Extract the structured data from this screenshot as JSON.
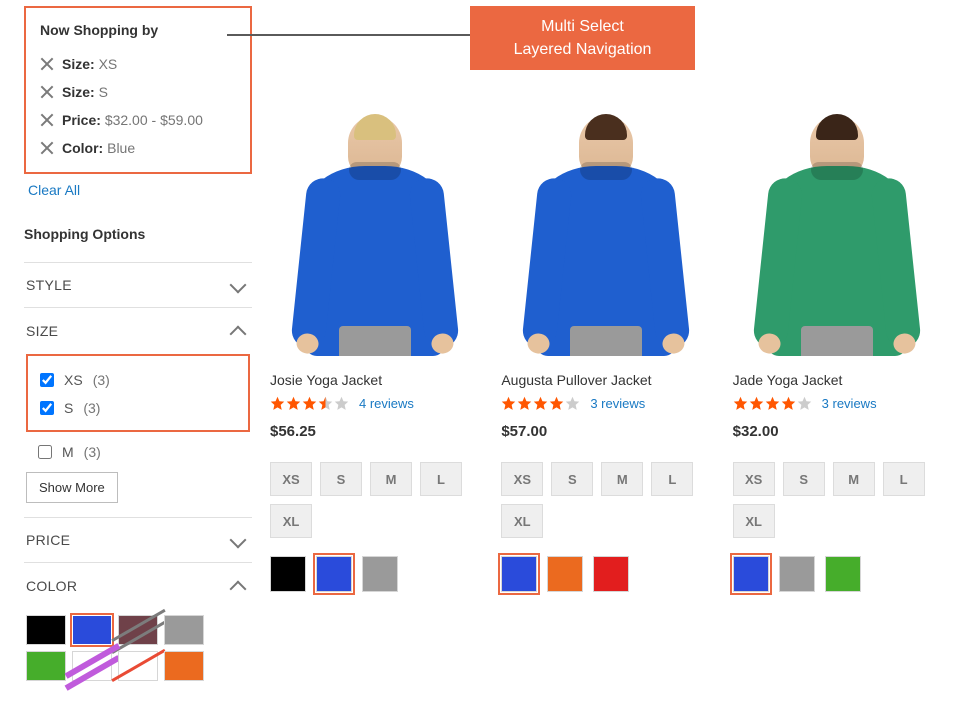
{
  "callout": {
    "line1": "Multi Select",
    "line2": "Layered Navigation"
  },
  "sidebar": {
    "now_shopping_title": "Now Shopping by",
    "applied": [
      {
        "label": "Size:",
        "value": "XS"
      },
      {
        "label": "Size:",
        "value": "S"
      },
      {
        "label": "Price:",
        "value": "$32.00 - $59.00"
      },
      {
        "label": "Color:",
        "value": "Blue"
      }
    ],
    "clear_all": "Clear All",
    "options_title": "Shopping Options",
    "facets": {
      "style": {
        "label": "STYLE",
        "expanded": false
      },
      "size": {
        "label": "SIZE",
        "expanded": true,
        "checked": [
          {
            "label": "XS",
            "count": "(3)"
          },
          {
            "label": "S",
            "count": "(3)"
          }
        ],
        "unchecked": [
          {
            "label": "M",
            "count": "(3)"
          }
        ],
        "show_more": "Show More"
      },
      "price": {
        "label": "PRICE",
        "expanded": false
      },
      "color": {
        "label": "COLOR",
        "expanded": true,
        "swatches": [
          {
            "name": "black",
            "hex": "#000000",
            "selected": false
          },
          {
            "name": "blue",
            "hex": "#2a4bdb",
            "selected": true
          },
          {
            "name": "maroon-stripe",
            "hex": "stripe-dark",
            "selected": false
          },
          {
            "name": "gray",
            "hex": "#9a9a9a",
            "selected": false
          },
          {
            "name": "green",
            "hex": "#46ad2b",
            "selected": false
          },
          {
            "name": "purple-stripe",
            "hex": "stripe-purple",
            "selected": false
          },
          {
            "name": "red-stripe",
            "hex": "stripe-red",
            "selected": false
          },
          {
            "name": "orange",
            "hex": "#eb6a1f",
            "selected": false
          }
        ]
      }
    }
  },
  "products": [
    {
      "name": "Josie Yoga Jacket",
      "rating_full": 3,
      "rating_half": 1,
      "reviews": "4 reviews",
      "price": "$56.25",
      "shirt_color": "#1f5fcf",
      "hair_color": "#d9c07e",
      "sizes": [
        "XS",
        "S",
        "M",
        "L",
        "XL"
      ],
      "colors": [
        {
          "hex": "#000000",
          "sel": false
        },
        {
          "hex": "#2a4bdb",
          "sel": true
        },
        {
          "hex": "#9a9a9a",
          "sel": false
        }
      ]
    },
    {
      "name": "Augusta Pullover Jacket",
      "rating_full": 4,
      "rating_half": 0,
      "reviews": "3 reviews",
      "price": "$57.00",
      "shirt_color": "#1f5fcf",
      "hair_color": "#4a2f1e",
      "sizes": [
        "XS",
        "S",
        "M",
        "L",
        "XL"
      ],
      "colors": [
        {
          "hex": "#2a4bdb",
          "sel": true
        },
        {
          "hex": "#eb6a1f",
          "sel": false
        },
        {
          "hex": "#e21e1e",
          "sel": false
        }
      ]
    },
    {
      "name": "Jade Yoga Jacket",
      "rating_full": 4,
      "rating_half": 0,
      "reviews": "3 reviews",
      "price": "$32.00",
      "shirt_color": "#2f9b6b",
      "hair_color": "#3a2518",
      "sizes": [
        "XS",
        "S",
        "M",
        "L",
        "XL"
      ],
      "colors": [
        {
          "hex": "#2a4bdb",
          "sel": true
        },
        {
          "hex": "#9a9a9a",
          "sel": false
        },
        {
          "hex": "#46ad2b",
          "sel": false
        }
      ]
    }
  ]
}
